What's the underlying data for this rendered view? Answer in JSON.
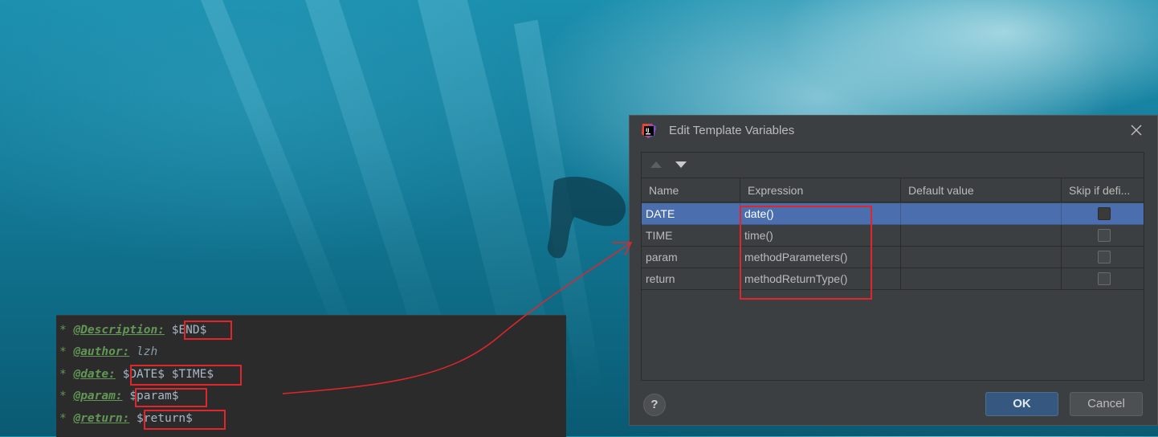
{
  "code_snippet": {
    "lines": [
      {
        "star": "*",
        "tag": "@Description:",
        "value": "$END$",
        "boxed": true
      },
      {
        "star": "*",
        "tag": "@author:",
        "value": "lzh",
        "boxed": false
      },
      {
        "star": "*",
        "tag": "@date:",
        "value": "$DATE$ $TIME$",
        "boxed": true
      },
      {
        "star": "*",
        "tag": "@param:",
        "value": "$param$",
        "boxed": true
      },
      {
        "star": "*",
        "tag": "@return:",
        "value": "$return$",
        "boxed": true
      }
    ]
  },
  "dialog": {
    "title": "Edit Template Variables",
    "app_icon": "intellij-idea-icon",
    "columns": [
      "Name",
      "Expression",
      "Default value",
      "Skip if defi..."
    ],
    "rows": [
      {
        "name": "DATE",
        "expression": "date()",
        "default": "",
        "skip": false,
        "selected": true
      },
      {
        "name": "TIME",
        "expression": "time()",
        "default": "",
        "skip": false,
        "selected": false
      },
      {
        "name": "param",
        "expression": "methodParameters()",
        "default": "",
        "skip": false,
        "selected": false
      },
      {
        "name": "return",
        "expression": "methodReturnType()",
        "default": "",
        "skip": false,
        "selected": false
      }
    ],
    "help_label": "?",
    "ok_label": "OK",
    "cancel_label": "Cancel"
  },
  "colors": {
    "annotation": "#e0262b",
    "selection": "#4b6eaf",
    "ok_button": "#365880"
  }
}
